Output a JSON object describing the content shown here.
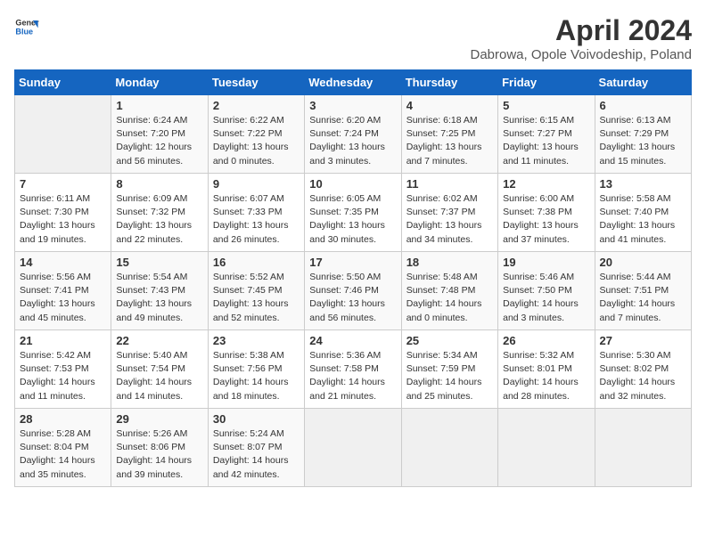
{
  "logo": {
    "line1": "General",
    "line2": "Blue"
  },
  "title": "April 2024",
  "subtitle": "Dabrowa, Opole Voivodeship, Poland",
  "days_of_week": [
    "Sunday",
    "Monday",
    "Tuesday",
    "Wednesday",
    "Thursday",
    "Friday",
    "Saturday"
  ],
  "weeks": [
    [
      {
        "day": "",
        "info": ""
      },
      {
        "day": "1",
        "info": "Sunrise: 6:24 AM\nSunset: 7:20 PM\nDaylight: 12 hours\nand 56 minutes."
      },
      {
        "day": "2",
        "info": "Sunrise: 6:22 AM\nSunset: 7:22 PM\nDaylight: 13 hours\nand 0 minutes."
      },
      {
        "day": "3",
        "info": "Sunrise: 6:20 AM\nSunset: 7:24 PM\nDaylight: 13 hours\nand 3 minutes."
      },
      {
        "day": "4",
        "info": "Sunrise: 6:18 AM\nSunset: 7:25 PM\nDaylight: 13 hours\nand 7 minutes."
      },
      {
        "day": "5",
        "info": "Sunrise: 6:15 AM\nSunset: 7:27 PM\nDaylight: 13 hours\nand 11 minutes."
      },
      {
        "day": "6",
        "info": "Sunrise: 6:13 AM\nSunset: 7:29 PM\nDaylight: 13 hours\nand 15 minutes."
      }
    ],
    [
      {
        "day": "7",
        "info": "Sunrise: 6:11 AM\nSunset: 7:30 PM\nDaylight: 13 hours\nand 19 minutes."
      },
      {
        "day": "8",
        "info": "Sunrise: 6:09 AM\nSunset: 7:32 PM\nDaylight: 13 hours\nand 22 minutes."
      },
      {
        "day": "9",
        "info": "Sunrise: 6:07 AM\nSunset: 7:33 PM\nDaylight: 13 hours\nand 26 minutes."
      },
      {
        "day": "10",
        "info": "Sunrise: 6:05 AM\nSunset: 7:35 PM\nDaylight: 13 hours\nand 30 minutes."
      },
      {
        "day": "11",
        "info": "Sunrise: 6:02 AM\nSunset: 7:37 PM\nDaylight: 13 hours\nand 34 minutes."
      },
      {
        "day": "12",
        "info": "Sunrise: 6:00 AM\nSunset: 7:38 PM\nDaylight: 13 hours\nand 37 minutes."
      },
      {
        "day": "13",
        "info": "Sunrise: 5:58 AM\nSunset: 7:40 PM\nDaylight: 13 hours\nand 41 minutes."
      }
    ],
    [
      {
        "day": "14",
        "info": "Sunrise: 5:56 AM\nSunset: 7:41 PM\nDaylight: 13 hours\nand 45 minutes."
      },
      {
        "day": "15",
        "info": "Sunrise: 5:54 AM\nSunset: 7:43 PM\nDaylight: 13 hours\nand 49 minutes."
      },
      {
        "day": "16",
        "info": "Sunrise: 5:52 AM\nSunset: 7:45 PM\nDaylight: 13 hours\nand 52 minutes."
      },
      {
        "day": "17",
        "info": "Sunrise: 5:50 AM\nSunset: 7:46 PM\nDaylight: 13 hours\nand 56 minutes."
      },
      {
        "day": "18",
        "info": "Sunrise: 5:48 AM\nSunset: 7:48 PM\nDaylight: 14 hours\nand 0 minutes."
      },
      {
        "day": "19",
        "info": "Sunrise: 5:46 AM\nSunset: 7:50 PM\nDaylight: 14 hours\nand 3 minutes."
      },
      {
        "day": "20",
        "info": "Sunrise: 5:44 AM\nSunset: 7:51 PM\nDaylight: 14 hours\nand 7 minutes."
      }
    ],
    [
      {
        "day": "21",
        "info": "Sunrise: 5:42 AM\nSunset: 7:53 PM\nDaylight: 14 hours\nand 11 minutes."
      },
      {
        "day": "22",
        "info": "Sunrise: 5:40 AM\nSunset: 7:54 PM\nDaylight: 14 hours\nand 14 minutes."
      },
      {
        "day": "23",
        "info": "Sunrise: 5:38 AM\nSunset: 7:56 PM\nDaylight: 14 hours\nand 18 minutes."
      },
      {
        "day": "24",
        "info": "Sunrise: 5:36 AM\nSunset: 7:58 PM\nDaylight: 14 hours\nand 21 minutes."
      },
      {
        "day": "25",
        "info": "Sunrise: 5:34 AM\nSunset: 7:59 PM\nDaylight: 14 hours\nand 25 minutes."
      },
      {
        "day": "26",
        "info": "Sunrise: 5:32 AM\nSunset: 8:01 PM\nDaylight: 14 hours\nand 28 minutes."
      },
      {
        "day": "27",
        "info": "Sunrise: 5:30 AM\nSunset: 8:02 PM\nDaylight: 14 hours\nand 32 minutes."
      }
    ],
    [
      {
        "day": "28",
        "info": "Sunrise: 5:28 AM\nSunset: 8:04 PM\nDaylight: 14 hours\nand 35 minutes."
      },
      {
        "day": "29",
        "info": "Sunrise: 5:26 AM\nSunset: 8:06 PM\nDaylight: 14 hours\nand 39 minutes."
      },
      {
        "day": "30",
        "info": "Sunrise: 5:24 AM\nSunset: 8:07 PM\nDaylight: 14 hours\nand 42 minutes."
      },
      {
        "day": "",
        "info": ""
      },
      {
        "day": "",
        "info": ""
      },
      {
        "day": "",
        "info": ""
      },
      {
        "day": "",
        "info": ""
      }
    ]
  ]
}
